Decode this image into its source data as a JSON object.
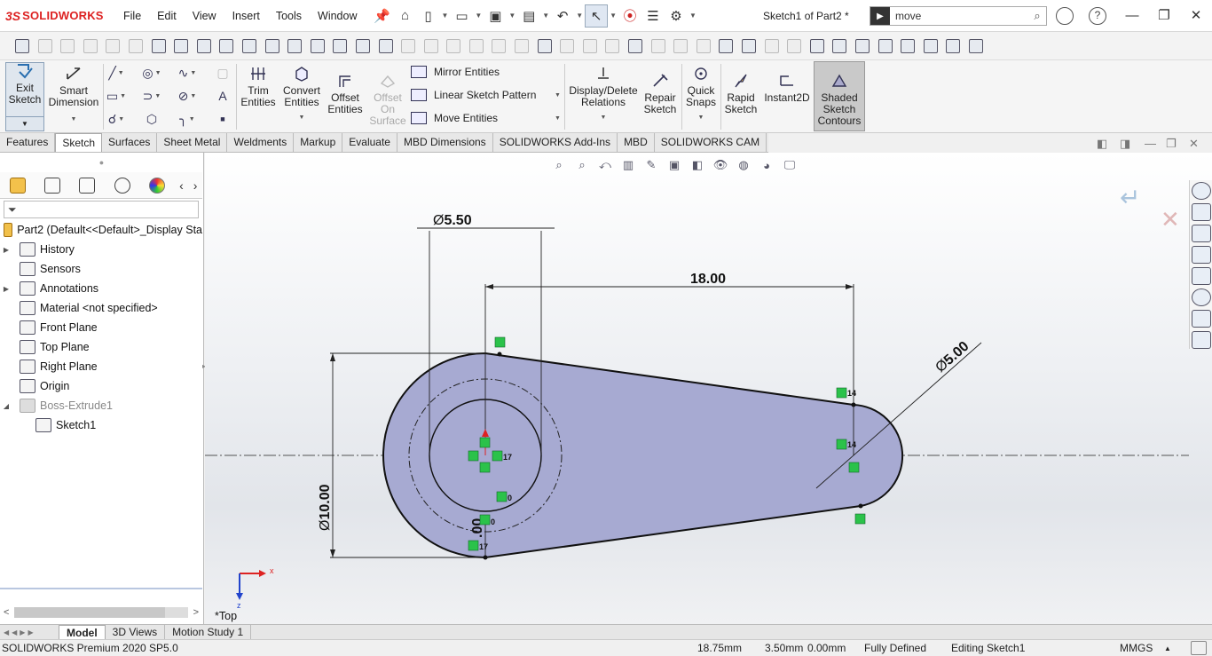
{
  "app": {
    "logo_ds": "3S",
    "logo_name": "SOLIDWORKS",
    "doc_title": "Sketch1 of Part2 *"
  },
  "menu": [
    "File",
    "Edit",
    "View",
    "Insert",
    "Tools",
    "Window"
  ],
  "search": {
    "value": "move"
  },
  "commands": {
    "exit_sketch": "Exit\nSketch",
    "smart_dimension": "Smart\nDimension",
    "trim": "Trim\nEntities",
    "convert": "Convert\nEntities",
    "offset": "Offset\nEntities",
    "offset_surface": "Offset\nOn\nSurface",
    "mirror": "Mirror Entities",
    "linear_pattern": "Linear Sketch Pattern",
    "move": "Move Entities",
    "display_delete": "Display/Delete\nRelations",
    "repair": "Repair\nSketch",
    "quick_snaps": "Quick\nSnaps",
    "rapid": "Rapid\nSketch",
    "instant2d": "Instant2D",
    "shaded": "Shaded\nSketch\nContours"
  },
  "tabs": [
    "Features",
    "Sketch",
    "Surfaces",
    "Sheet Metal",
    "Weldments",
    "Markup",
    "Evaluate",
    "MBD Dimensions",
    "SOLIDWORKS Add-Ins",
    "MBD",
    "SOLIDWORKS CAM"
  ],
  "active_tab": "Sketch",
  "tree": {
    "root": "Part2  (Default<<Default>_Display Sta",
    "items": [
      {
        "label": "History",
        "expandable": true
      },
      {
        "label": "Sensors",
        "expandable": false
      },
      {
        "label": "Annotations",
        "expandable": true
      },
      {
        "label": "Material <not specified>",
        "expandable": false
      },
      {
        "label": "Front Plane",
        "expandable": false
      },
      {
        "label": "Top Plane",
        "expandable": false
      },
      {
        "label": "Right Plane",
        "expandable": false
      },
      {
        "label": "Origin",
        "expandable": false
      },
      {
        "label": "Boss-Extrude1",
        "expandable": true,
        "expanded": true,
        "dim": true
      },
      {
        "label": "Sketch1",
        "expandable": false,
        "child": true
      }
    ]
  },
  "sketch": {
    "dim_hole_dia": "5.50",
    "dim_center_dist": "18.00",
    "dim_small_dia": "5.00",
    "dim_big_dia": "10.00",
    "dim_offset": ".00",
    "relation_labels": [
      "14",
      "14",
      "17",
      "0",
      "0",
      "17"
    ],
    "dia_symbol": "Ø",
    "view_name": "*Top",
    "axis_x": "x",
    "axis_z": "z"
  },
  "bottom_tabs": [
    "Model",
    "3D Views",
    "Motion Study 1"
  ],
  "active_bottom_tab": "Model",
  "status": {
    "product": "SOLIDWORKS Premium 2020 SP5.0",
    "coord1": "18.75mm",
    "coord2": "3.50mm",
    "coord3": "0.00mm",
    "state": "Fully Defined",
    "editing": "Editing Sketch1",
    "units": "MMGS"
  }
}
